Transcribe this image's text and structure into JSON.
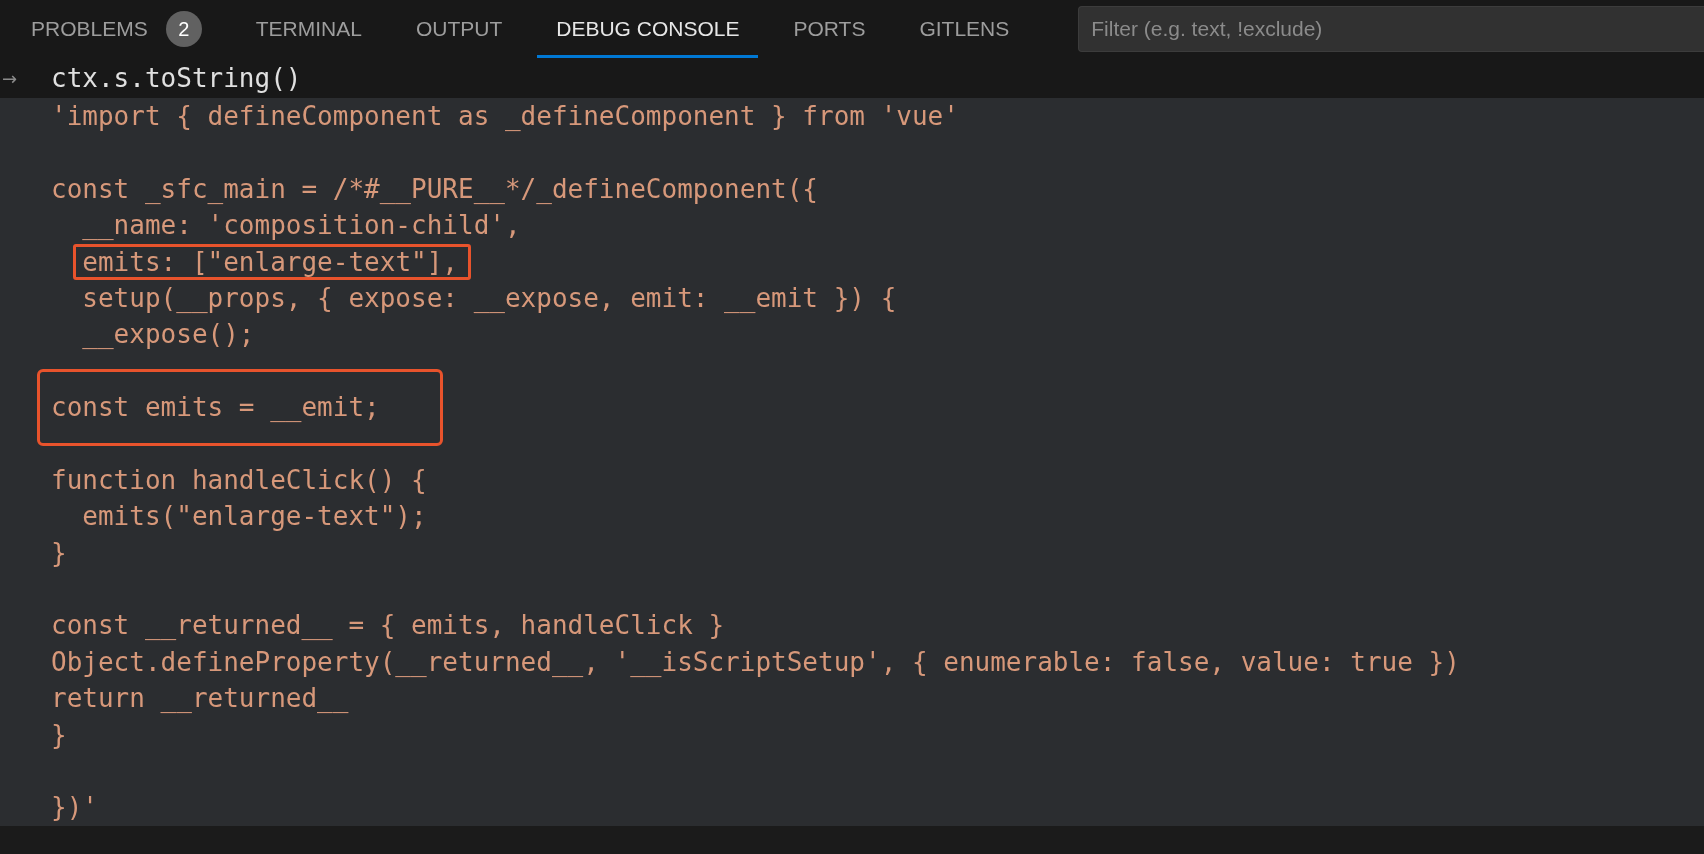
{
  "panel_tabs": [
    {
      "label": "PROBLEMS",
      "selected": false,
      "badge": "2"
    },
    {
      "label": "TERMINAL",
      "selected": false
    },
    {
      "label": "OUTPUT",
      "selected": false
    },
    {
      "label": "DEBUG CONSOLE",
      "selected": true
    },
    {
      "label": "PORTS",
      "selected": false
    },
    {
      "label": "GITLENS",
      "selected": false
    }
  ],
  "filter": {
    "placeholder": "Filter (e.g. text, !exclude)"
  },
  "console": {
    "input": {
      "prompt": "→",
      "text": "ctx.s.toString()"
    },
    "output": [
      {
        "kind": "code",
        "text": "'import { defineComponent as _defineComponent } from 'vue'"
      },
      {
        "kind": "blank"
      },
      {
        "kind": "code",
        "text": "const _sfc_main = /*#__PURE__*/_defineComponent({"
      },
      {
        "kind": "code",
        "text": "  __name: 'composition-child',"
      },
      {
        "kind": "mark-inline",
        "text": "  emits: [\"enlarge-text\"],"
      },
      {
        "kind": "code",
        "text": "  setup(__props, { expose: __expose, emit: __emit }) {"
      },
      {
        "kind": "code",
        "text": "  __expose();"
      },
      {
        "kind": "blank"
      },
      {
        "kind": "mark-block",
        "text": "const emits = __emit;"
      },
      {
        "kind": "blank"
      },
      {
        "kind": "code",
        "text": "function handleClick() {"
      },
      {
        "kind": "code",
        "text": "  emits(\"enlarge-text\");"
      },
      {
        "kind": "code",
        "text": "}"
      },
      {
        "kind": "blank"
      },
      {
        "kind": "code",
        "text": "const __returned__ = { emits, handleClick }"
      },
      {
        "kind": "code",
        "text": "Object.defineProperty(__returned__, '__isScriptSetup', { enumerable: false, value: true })"
      },
      {
        "kind": "code",
        "text": "return __returned__"
      },
      {
        "kind": "code",
        "text": "}"
      },
      {
        "kind": "blank"
      },
      {
        "kind": "code",
        "text": "})'"
      }
    ]
  }
}
